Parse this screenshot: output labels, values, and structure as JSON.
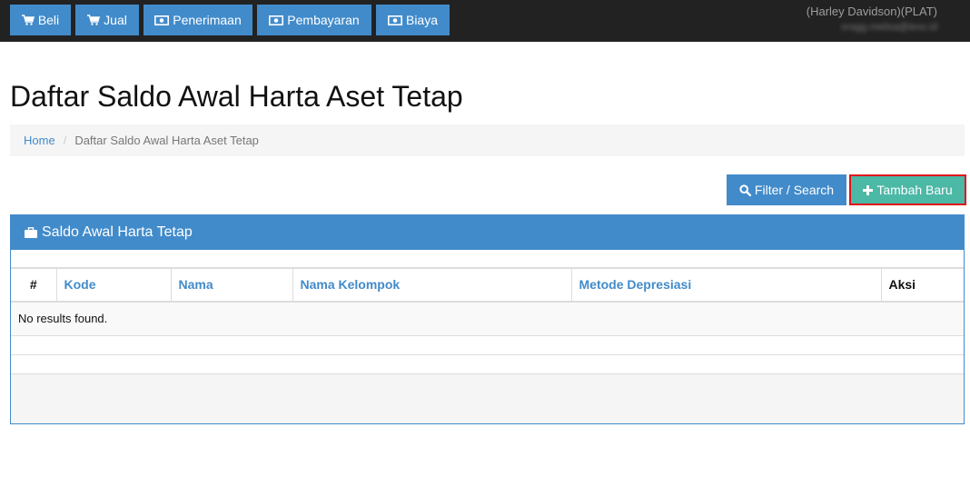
{
  "nav": {
    "items": [
      {
        "label": "Beli",
        "icon": "cart-icon"
      },
      {
        "label": "Jual",
        "icon": "cart-icon"
      },
      {
        "label": "Penerimaan",
        "icon": "money-icon"
      },
      {
        "label": "Pembayaran",
        "icon": "money-icon"
      },
      {
        "label": "Biaya",
        "icon": "money-icon"
      }
    ],
    "user": {
      "name": "(Harley Davidson)(PLAT)",
      "email": "oragg.melisa@lexo.id"
    }
  },
  "page": {
    "title": "Daftar Saldo Awal Harta Aset Tetap"
  },
  "breadcrumb": {
    "home": "Home",
    "current": "Daftar Saldo Awal Harta Aset Tetap"
  },
  "actions": {
    "filter_label": "Filter / Search",
    "add_label": "Tambah Baru"
  },
  "panel": {
    "title": "Saldo Awal Harta Tetap",
    "columns": [
      "#",
      "Kode",
      "Nama",
      "Nama Kelompok",
      "Metode Depresiasi",
      "Aksi"
    ],
    "empty_text": "No results found."
  },
  "colors": {
    "primary": "#428bca",
    "add": "#4cb8a6",
    "highlight": "#e0101a",
    "topbar": "#222222"
  }
}
